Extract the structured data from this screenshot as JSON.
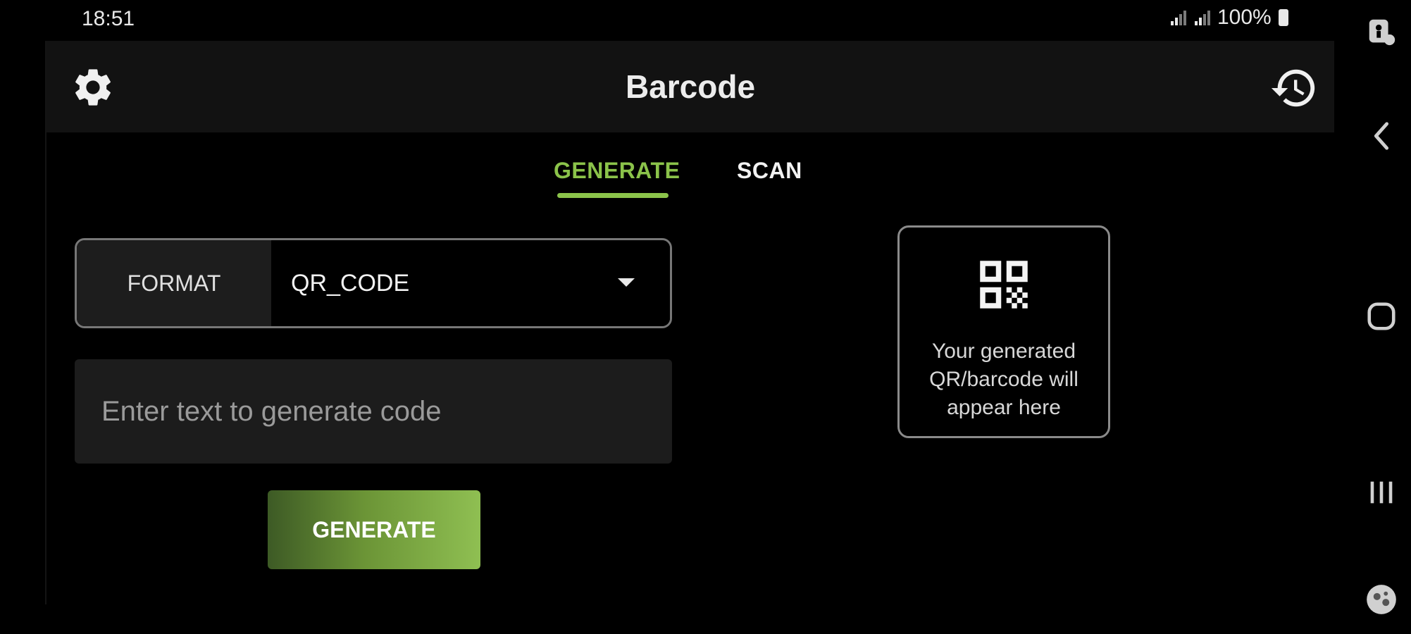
{
  "status_bar": {
    "time": "18:51",
    "battery": "100%"
  },
  "toolbar": {
    "title": "Barcode",
    "left_icon": "gear-icon",
    "right_icon": "history-icon"
  },
  "tabs": [
    {
      "label": "GENERATE",
      "active": true
    },
    {
      "label": "SCAN",
      "active": false
    }
  ],
  "form": {
    "format_label": "FORMAT",
    "format_value": "QR_CODE",
    "input_placeholder": "Enter text to generate code",
    "input_value": "",
    "generate_label": "GENERATE"
  },
  "preview": {
    "icon": "qr-code-icon",
    "text": "Your generated QR/barcode will appear here"
  },
  "nav_rail": {
    "icons": [
      "accessibility-icon",
      "back-icon",
      "home-icon",
      "recents-icon",
      "assistant-icon"
    ]
  },
  "colors": {
    "accent": "#8bc34a",
    "toolbar_bg": "#121212",
    "input_bg": "#1c1c1c"
  }
}
